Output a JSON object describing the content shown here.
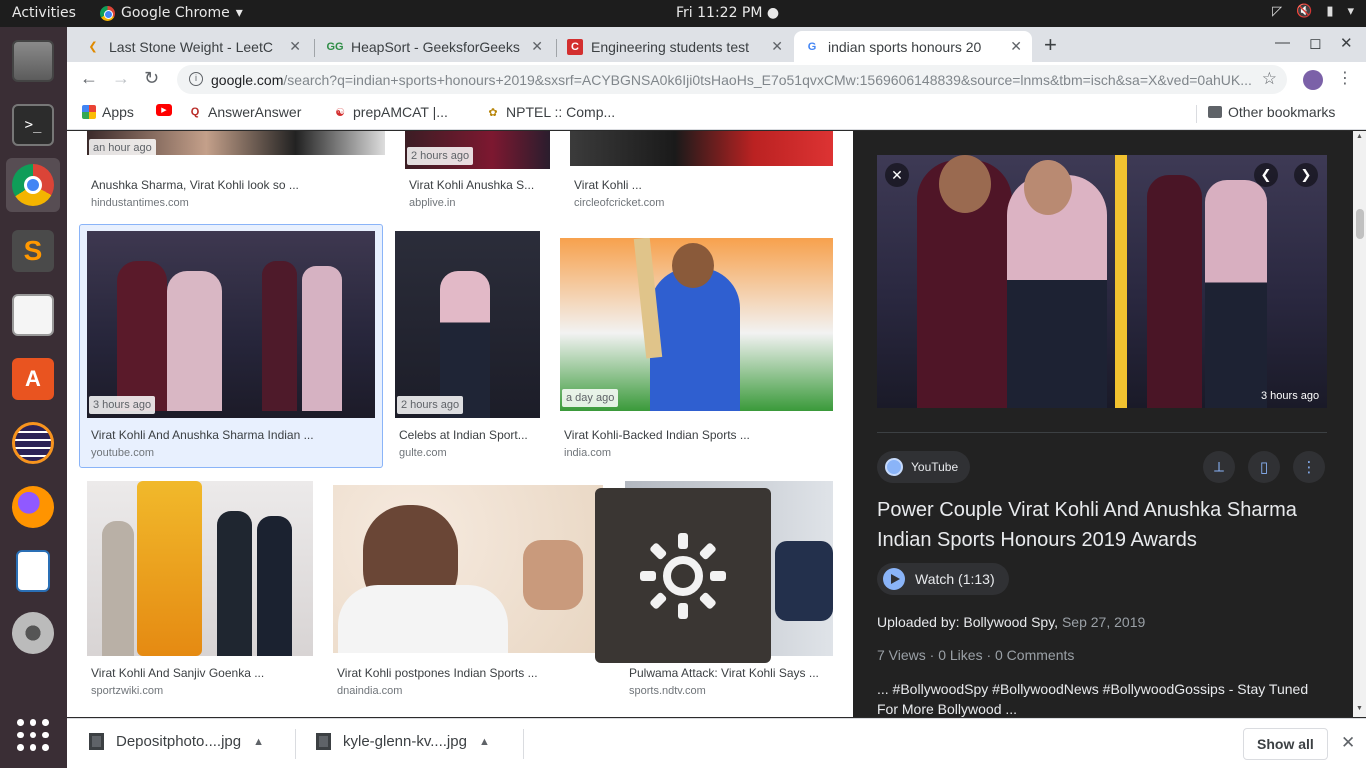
{
  "topbar": {
    "activities": "Activities",
    "app": "Google Chrome",
    "clock": "Fri 11:22 PM ●"
  },
  "tabs": [
    {
      "title": "Last Stone Weight - LeetC",
      "favicon": "leetcode-icon"
    },
    {
      "title": "HeapSort - GeeksforGeeks",
      "favicon": "geeksforgeeks-icon"
    },
    {
      "title": "Engineering students test",
      "favicon": "careers360-icon"
    },
    {
      "title": "indian sports honours 20",
      "favicon": "google-icon"
    }
  ],
  "omnibox": {
    "host": "google.com",
    "rest": "/search?q=indian+sports+honours+2019&sxsrf=ACYBGNSA0k6Iji0tsHaoHs_E7o51qvxCMw:1569606148839&source=lnms&tbm=isch&sa=X&ved=0ahUK..."
  },
  "bookmarks": {
    "items": [
      "Apps",
      "",
      "AnswerAnswer",
      "prepAMCAT |...",
      "NPTEL :: Comp..."
    ],
    "other": "Other bookmarks"
  },
  "results": {
    "row1": [
      {
        "time": "an hour ago",
        "caption": "Anushka Sharma, Virat Kohli look so ...",
        "domain": "hindustantimes.com"
      },
      {
        "time": "2 hours ago",
        "caption": "Virat Kohli Anushka S...",
        "domain": "abplive.in"
      },
      {
        "time": "",
        "caption": "Virat Kohli ...",
        "domain": "circleofcricket.com"
      }
    ],
    "row2": [
      {
        "time": "3 hours ago",
        "caption": "Virat Kohli And Anushka Sharma Indian ...",
        "domain": "youtube.com"
      },
      {
        "time": "2 hours ago",
        "caption": "Celebs at Indian Sport...",
        "domain": "gulte.com"
      },
      {
        "time": "a day ago",
        "caption": "Virat Kohli-Backed Indian Sports ...",
        "domain": "india.com"
      }
    ],
    "row3": [
      {
        "time": "",
        "caption": "Virat Kohli And Sanjiv Goenka ...",
        "domain": "sportzwiki.com"
      },
      {
        "time": "",
        "caption": "Virat Kohli postpones Indian Sports ...",
        "domain": "dnaindia.com"
      },
      {
        "time": "",
        "caption": "Pulwama Attack: Virat Kohli Says ...",
        "domain": "sports.ndtv.com"
      }
    ]
  },
  "panel": {
    "time": "3 hours ago",
    "source": "YouTube",
    "title": "Power Couple Virat Kohli And Anushka Sharma Indian Sports Honours 2019 Awards",
    "watch": "Watch (1:13)",
    "uploaded_label": "Uploaded by: Bollywood Spy,",
    "uploaded_date": "Sep 27, 2019",
    "stats": "7 Views  ·  0 Likes  ·  0 Comments",
    "desc": "... #BollywoodSpy #BollywoodNews #BollywoodGossips - Stay Tuned For More Bollywood ..."
  },
  "downloads": {
    "items": [
      "Depositphoto....jpg",
      "kyle-glenn-kv....jpg"
    ],
    "show_all": "Show all"
  },
  "colors": {
    "panel_bg": "#222222",
    "accent": "#8ab4f8",
    "launcher_bg": "#3a2e35"
  }
}
